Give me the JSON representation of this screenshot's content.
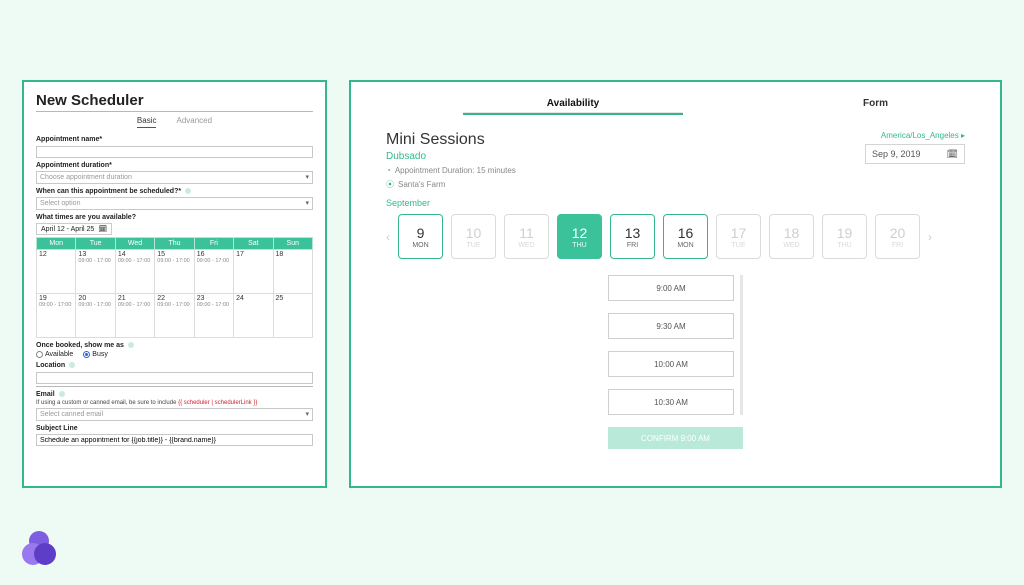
{
  "left": {
    "title": "New Scheduler",
    "tabs": {
      "basic": "Basic",
      "advanced": "Advanced"
    },
    "fields": {
      "name_label": "Appointment name*",
      "duration_label": "Appointment duration*",
      "duration_placeholder": "Choose appointment duration",
      "sched_label": "When can this appointment be scheduled?*",
      "sched_placeholder": "Select option",
      "avail_label": "What times are you available?",
      "date_range": "April 12 - April 25",
      "cal_days": [
        "Mon",
        "Tue",
        "Wed",
        "Thu",
        "Fri",
        "Sat",
        "Sun"
      ],
      "week1": [
        {
          "d": "12",
          "r": ""
        },
        {
          "d": "13",
          "r": "09:00 - 17:00"
        },
        {
          "d": "14",
          "r": "09:00 - 17:00"
        },
        {
          "d": "15",
          "r": "09:00 - 17:00"
        },
        {
          "d": "16",
          "r": "09:00 - 17:00"
        },
        {
          "d": "17",
          "r": ""
        },
        {
          "d": "18",
          "r": ""
        }
      ],
      "week2": [
        {
          "d": "19",
          "r": "09:00 - 17:00"
        },
        {
          "d": "20",
          "r": "09:00 - 17:00"
        },
        {
          "d": "21",
          "r": "09:00 - 17:00"
        },
        {
          "d": "22",
          "r": "09:00 - 17:00"
        },
        {
          "d": "23",
          "r": "09:00 - 17:00"
        },
        {
          "d": "24",
          "r": ""
        },
        {
          "d": "25",
          "r": ""
        }
      ],
      "booked_label": "Once booked, show me as",
      "radio_available": "Available",
      "radio_busy": "Busy",
      "location_label": "Location",
      "email_label": "Email",
      "email_help_pre": "If using a custom or canned email, be sure to include ",
      "email_help_tpl": "{{ scheduler | schedulerLink }}",
      "canned_placeholder": "Select canned email",
      "subject_label": "Subject Line",
      "subject_value": "Schedule an appointment for {{job.title}} - {{brand.name}}"
    }
  },
  "right": {
    "tabs": {
      "avail": "Availability",
      "form": "Form"
    },
    "title": "Mini Sessions",
    "vendor": "Dubsado",
    "duration_meta": "Appointment Duration: 15 minutes",
    "location_meta": "Santa's Farm",
    "timezone": "America/Los_Angeles",
    "date_picker": "Sep 9, 2019",
    "month_label": "September",
    "days": [
      {
        "num": "9",
        "dow": "MON",
        "state": "active"
      },
      {
        "num": "10",
        "dow": "TUE",
        "state": "inactive"
      },
      {
        "num": "11",
        "dow": "WED",
        "state": "inactive"
      },
      {
        "num": "12",
        "dow": "THU",
        "state": "selected"
      },
      {
        "num": "13",
        "dow": "FRI",
        "state": "active"
      },
      {
        "num": "16",
        "dow": "MON",
        "state": "active"
      },
      {
        "num": "17",
        "dow": "TUE",
        "state": "inactive"
      },
      {
        "num": "18",
        "dow": "WED",
        "state": "inactive"
      },
      {
        "num": "19",
        "dow": "THU",
        "state": "inactive"
      },
      {
        "num": "20",
        "dow": "FRI",
        "state": "inactive"
      }
    ],
    "slots": [
      "9:00 AM",
      "9:30 AM",
      "10:00 AM",
      "10:30 AM"
    ],
    "confirm_label": "CONFIRM 9:00 AM"
  }
}
